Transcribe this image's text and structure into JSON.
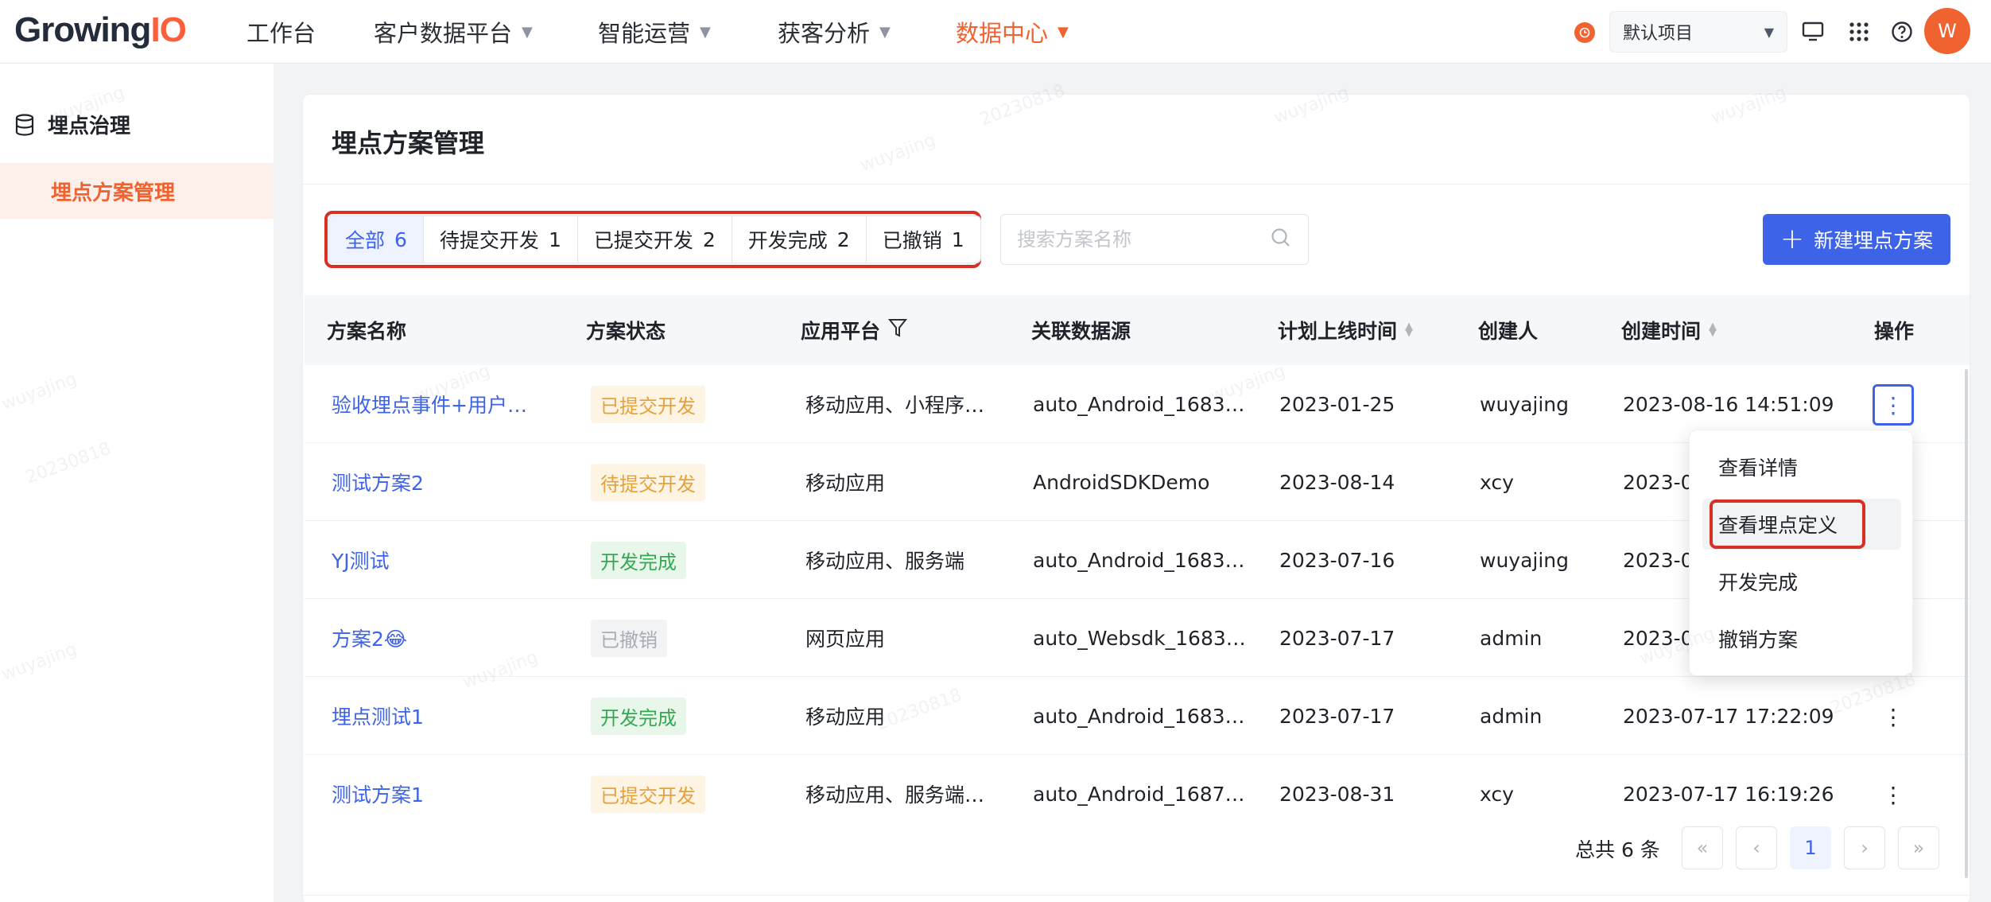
{
  "brand": {
    "logo_main": "Growing",
    "logo_accent": "IO"
  },
  "nav": {
    "items": [
      {
        "label": "工作台"
      },
      {
        "label": "客户数据平台"
      },
      {
        "label": "智能运营"
      },
      {
        "label": "获客分析"
      },
      {
        "label": "数据中心"
      }
    ],
    "project": "默认项目",
    "avatar_letter": "W"
  },
  "sidebar": {
    "group_label": "埋点治理",
    "item_label": "埋点方案管理"
  },
  "page": {
    "title": "埋点方案管理",
    "tabs": [
      {
        "label": "全部",
        "count": "6"
      },
      {
        "label": "待提交开发",
        "count": "1"
      },
      {
        "label": "已提交开发",
        "count": "2"
      },
      {
        "label": "开发完成",
        "count": "2"
      },
      {
        "label": "已撤销",
        "count": "1"
      }
    ],
    "search_placeholder": "搜索方案名称",
    "new_button": "新建埋点方案"
  },
  "table": {
    "headers": {
      "name": "方案名称",
      "status": "方案状态",
      "platform": "应用平台",
      "datasource": "关联数据源",
      "plan_date": "计划上线时间",
      "creator": "创建人",
      "created": "创建时间",
      "actions": "操作"
    },
    "rows": [
      {
        "name": "验收埋点事件+用户…",
        "status": "已提交开发",
        "status_type": "orange",
        "platform": "移动应用、小程序…",
        "datasource": "auto_Android_1683…",
        "plan_date": "2023-01-25",
        "creator": "wuyajing",
        "created": "2023-08-16 14:51:09"
      },
      {
        "name": "测试方案2",
        "status": "待提交开发",
        "status_type": "yellow",
        "platform": "移动应用",
        "datasource": "AndroidSDKDemo",
        "plan_date": "2023-08-14",
        "creator": "xcy",
        "created": "2023-0"
      },
      {
        "name": "YJ测试",
        "status": "开发完成",
        "status_type": "green",
        "platform": "移动应用、服务端",
        "datasource": "auto_Android_1683…",
        "plan_date": "2023-07-16",
        "creator": "wuyajing",
        "created": "2023-0"
      },
      {
        "name": "方案2😂",
        "status": "已撤销",
        "status_type": "gray",
        "platform": "网页应用",
        "datasource": "auto_Websdk_1683…",
        "plan_date": "2023-07-17",
        "creator": "admin",
        "created": "2023-0"
      },
      {
        "name": "埋点测试1",
        "status": "开发完成",
        "status_type": "green",
        "platform": "移动应用",
        "datasource": "auto_Android_1683…",
        "plan_date": "2023-07-17",
        "creator": "admin",
        "created": "2023-07-17 17:22:09"
      },
      {
        "name": "测试方案1",
        "status": "已提交开发",
        "status_type": "orange",
        "platform": "移动应用、服务端…",
        "datasource": "auto_Android_1687…",
        "plan_date": "2023-08-31",
        "creator": "xcy",
        "created": "2023-07-17 16:19:26"
      }
    ]
  },
  "menu": {
    "items": [
      "查看详情",
      "查看埋点定义",
      "开发完成",
      "撤销方案"
    ]
  },
  "pagination": {
    "total": "总共 6 条",
    "current_page": "1"
  },
  "watermark": {
    "name": "wuyajing",
    "date": "20230818"
  },
  "colors": {
    "accent": "#f0622f",
    "primary": "#3d63e8",
    "highlight": "#d93026"
  }
}
